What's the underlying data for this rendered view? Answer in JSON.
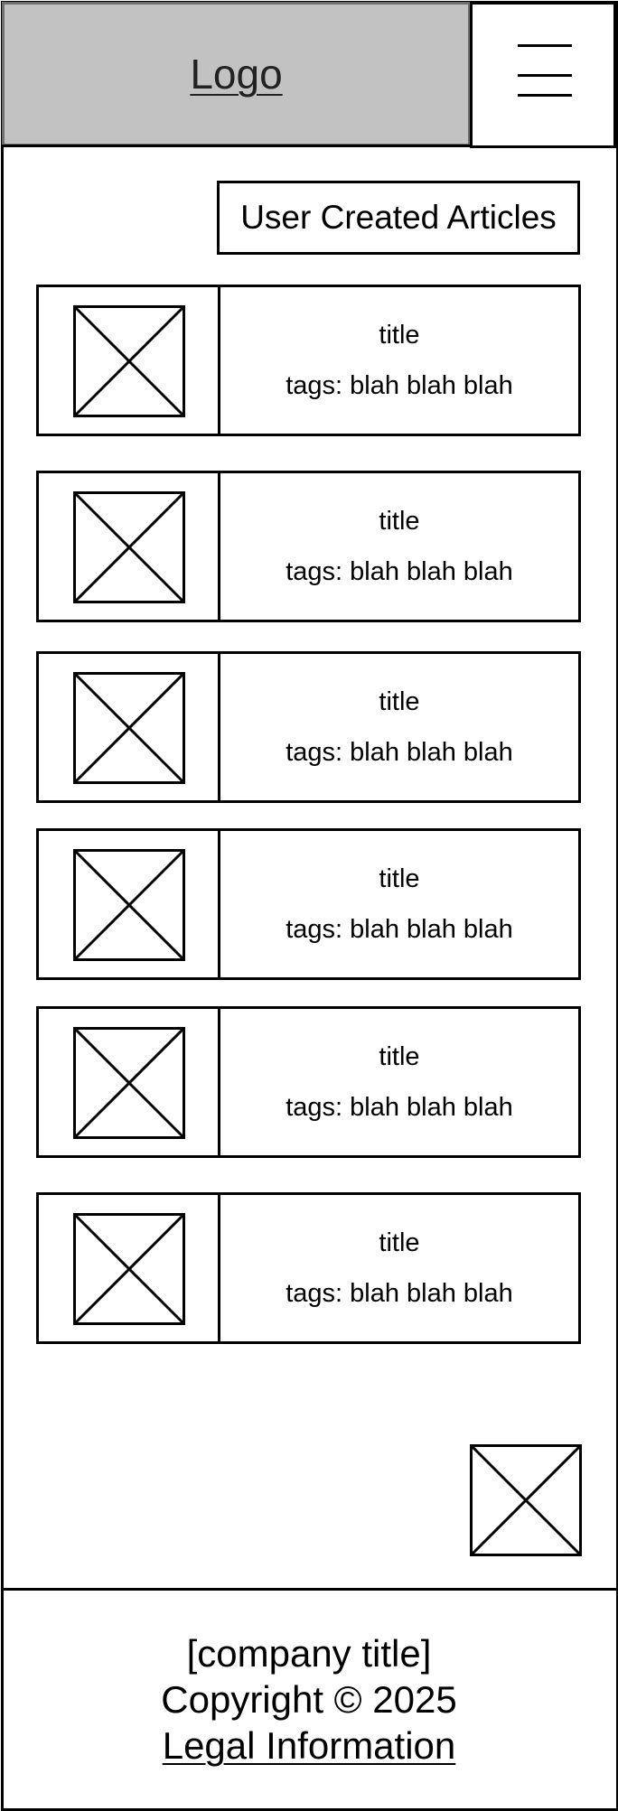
{
  "header": {
    "logo_label": "Logo",
    "menu_icon": "hamburger-menu-icon"
  },
  "main": {
    "section_label": "User Created Articles",
    "articles": [
      {
        "title": "title",
        "tags": "tags: blah blah blah",
        "thumbnail_icon": "image-placeholder-icon"
      },
      {
        "title": "title",
        "tags": "tags: blah blah blah",
        "thumbnail_icon": "image-placeholder-icon"
      },
      {
        "title": "title",
        "tags": "tags: blah blah blah",
        "thumbnail_icon": "image-placeholder-icon"
      },
      {
        "title": "title",
        "tags": "tags: blah blah blah",
        "thumbnail_icon": "image-placeholder-icon"
      },
      {
        "title": "title",
        "tags": "tags: blah blah blah",
        "thumbnail_icon": "image-placeholder-icon"
      },
      {
        "title": "title",
        "tags": "tags: blah blah blah",
        "thumbnail_icon": "image-placeholder-icon"
      }
    ],
    "floating_image_icon": "image-placeholder-icon"
  },
  "footer": {
    "company": "[company title]",
    "copyright": "Copyright © 2025",
    "legal_link": "Legal Information"
  },
  "colors": {
    "header_background": "#c2c2c2",
    "border": "#000000",
    "background": "#ffffff"
  }
}
